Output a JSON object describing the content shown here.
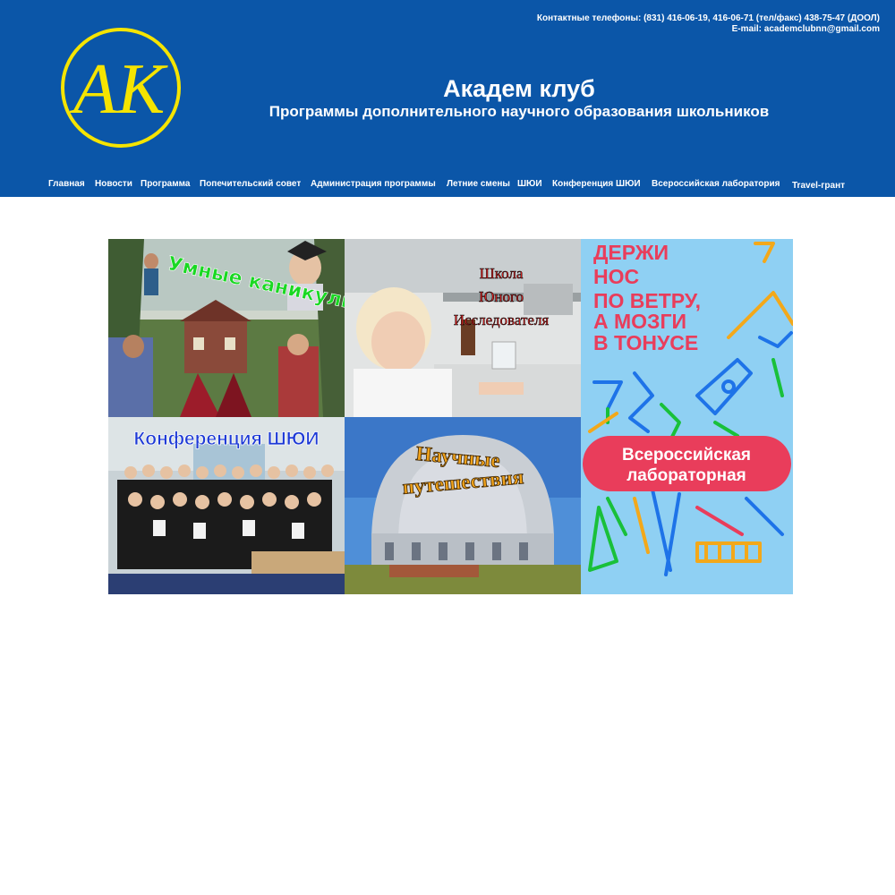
{
  "header": {
    "contacts_line1": "Контактные телефоны: (831) 416-06-19, 416-06-71 (тел/факс) 438-75-47 (ДООЛ)",
    "contacts_line2": "E-mail: academclubnn@gmail.com",
    "title": "Академ клуб",
    "subtitle": "Программы дополнительного научного образования школьников",
    "logo_text": "АК",
    "colors": {
      "background": "#0b56a8",
      "logo_ring": "#f5e400"
    }
  },
  "nav": {
    "items": [
      "Главная",
      "Новости",
      "Программа",
      "Попечительский совет",
      "Администрация программы",
      "Летние смены",
      "ШЮИ",
      "Конференция ШЮИ",
      "Всероссийская лаборатория",
      "Travel-грант"
    ]
  },
  "tiles": {
    "smart_holidays": {
      "caption": "Умные каникулы"
    },
    "school": {
      "line1": "Школа",
      "line2": "Юного",
      "line3": "Исследователя"
    },
    "poster": {
      "line1": "ДЕРЖИ",
      "line2": "НОС",
      "line3": "ПО ВЕТРУ,",
      "line4": "А МОЗГИ",
      "line5": "В ТОНУСЕ",
      "badge1": "Всероссийская",
      "badge2": "лабораторная",
      "colors": {
        "bg": "#8fd0f3",
        "accent_red": "#e93d5b",
        "accent_blue": "#1e73e8"
      }
    },
    "conference": {
      "caption": "Конференция ШЮИ"
    },
    "travel": {
      "line1": "Научные",
      "line2": "путешествия"
    }
  }
}
